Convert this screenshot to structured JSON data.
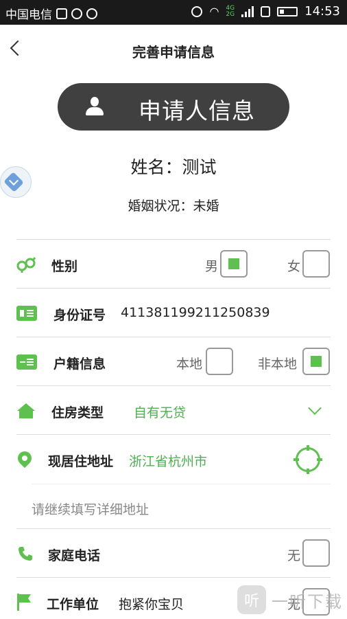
{
  "status_bar": {
    "carrier": "中国电信",
    "network_top": "4G",
    "network_bottom": "2G",
    "time": "14:53"
  },
  "nav": {
    "title": "完善申请信息",
    "back_icon": "back-arrow-icon"
  },
  "header_pill": {
    "label": "申请人信息",
    "icon": "person-icon"
  },
  "applicant": {
    "name_line": "姓名：测试",
    "marital_line": "婚姻状况：未婚"
  },
  "rows": {
    "gender": {
      "label": "性别",
      "icon": "gender-icon",
      "option_male": "男",
      "option_female": "女",
      "selected": "男"
    },
    "id_number": {
      "label": "身份证号",
      "icon": "id-card-icon",
      "value": "411381199211250839"
    },
    "household": {
      "label": "户籍信息",
      "icon": "household-card-icon",
      "option_local": "本地",
      "option_nonlocal": "非本地",
      "selected": "非本地"
    },
    "housing": {
      "label": "住房类型",
      "icon": "home-icon",
      "value": "自有无贷",
      "dropdown_icon": "chevron-down-icon"
    },
    "address": {
      "label": "现居住地址",
      "icon": "location-pin-icon",
      "value": "浙江省杭州市",
      "locate_icon": "locate-target-icon"
    },
    "address_detail": {
      "placeholder": "请继续填写详细地址"
    },
    "home_phone": {
      "label": "家庭电话",
      "icon": "phone-icon",
      "option_none": "无"
    },
    "employer": {
      "label": "工作单位",
      "icon": "flag-icon",
      "value": "抱紧你宝贝",
      "option_none": "无"
    }
  },
  "watermark": {
    "logo": "听",
    "text": "一听下载"
  },
  "colors": {
    "accent": "#5ec04f",
    "pill_bg": "#404040",
    "status_bar": "#1a1a1a"
  }
}
